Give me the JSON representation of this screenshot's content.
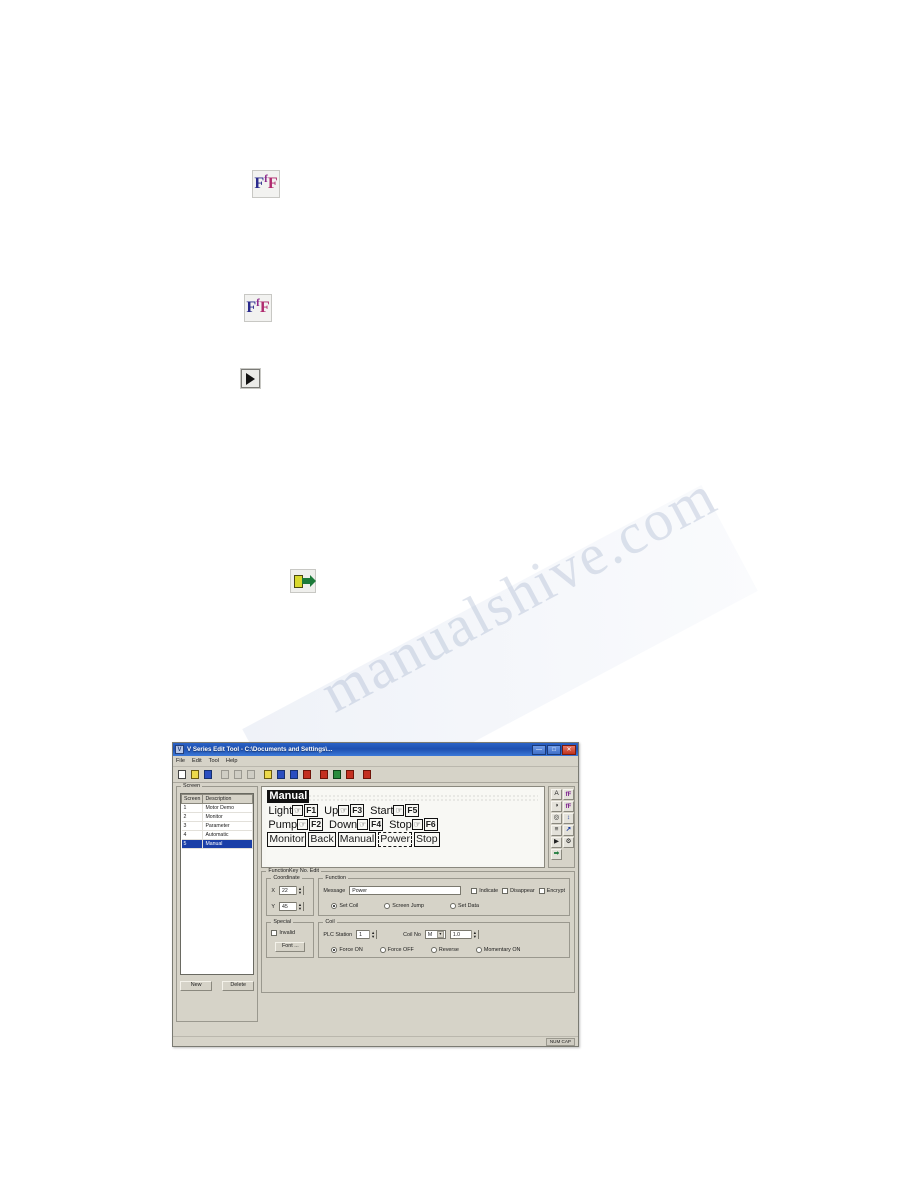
{
  "page": {
    "watermark_text_1": "manualshive.com",
    "watermark_text_2": ".com"
  },
  "page_icons": [
    {
      "name": "font-ff-icon-1",
      "glyph_left": "F",
      "glyph_mid": "f",
      "glyph_right": "F"
    },
    {
      "name": "font-ff-icon-2",
      "glyph_left": "F",
      "glyph_mid": "f",
      "glyph_right": "F"
    },
    {
      "name": "play-button-icon",
      "glyph": "▶"
    },
    {
      "name": "download-to-plc-icon",
      "glyph": "➡"
    }
  ],
  "window": {
    "title": "V Series Edit Tool - C:\\Documents and Settings\\...",
    "title_icon": "app-icon",
    "buttons": {
      "minimize": "—",
      "maximize": "□",
      "close": "✕"
    },
    "menu": [
      "File",
      "Edit",
      "Tool",
      "Help"
    ],
    "toolbar": [
      {
        "name": "new-file-button",
        "kind": "white"
      },
      {
        "name": "open-file-button",
        "kind": "yellow"
      },
      {
        "name": "save-file-button",
        "kind": "blue"
      },
      {
        "name": "cut-button",
        "kind": "disabled"
      },
      {
        "name": "copy-button",
        "kind": "disabled"
      },
      {
        "name": "paste-button",
        "kind": "disabled"
      },
      {
        "name": "screen-new-button",
        "kind": "yellow"
      },
      {
        "name": "screen-edit-button",
        "kind": "blue"
      },
      {
        "name": "screen-link-button",
        "kind": "blue"
      },
      {
        "name": "screen-delete-button",
        "kind": "red"
      },
      {
        "name": "upload-button",
        "kind": "red"
      },
      {
        "name": "download-button",
        "kind": "green"
      },
      {
        "name": "monitor-button",
        "kind": "red"
      },
      {
        "name": "transfer-button",
        "kind": "red"
      }
    ],
    "screen_group": {
      "legend": "Screen",
      "columns": [
        "Screen",
        "Description"
      ],
      "rows": [
        {
          "no": "1",
          "description": "Motor Demo",
          "selected": false
        },
        {
          "no": "2",
          "description": "Monitor",
          "selected": false
        },
        {
          "no": "3",
          "description": "Parameter",
          "selected": false
        },
        {
          "no": "4",
          "description": "Automatic",
          "selected": false
        },
        {
          "no": "5",
          "description": "Manual",
          "selected": true
        }
      ],
      "new_button": "New",
      "delete_button": "Delete"
    },
    "canvas": {
      "screen_title": "Manual",
      "function_rows": [
        [
          {
            "label": "Light",
            "key": "F1"
          },
          {
            "label": "Up",
            "key": "F3"
          },
          {
            "label": "Start",
            "key": "F5"
          }
        ],
        [
          {
            "label": "Pump",
            "key": "F2"
          },
          {
            "label": "Down",
            "key": "F4"
          },
          {
            "label": "Stop",
            "key": "F6"
          }
        ]
      ],
      "buttons": [
        {
          "label": "Monitor",
          "selected": false
        },
        {
          "label": "Back",
          "selected": false
        },
        {
          "label": "Manual",
          "selected": false
        },
        {
          "label": "Power",
          "selected": true
        },
        {
          "label": "Stop",
          "selected": false
        }
      ],
      "hand_glyph": "☞"
    },
    "palette": [
      {
        "name": "text-tool-button",
        "glyph": "A"
      },
      {
        "name": "font-tool-button",
        "glyph": "fF"
      },
      {
        "name": "lamp-tool-button",
        "glyph": "◑"
      },
      {
        "name": "function-key-tool-button",
        "glyph": "fF"
      },
      {
        "name": "switch-tool-button",
        "glyph": "◎"
      },
      {
        "name": "numeric-display-tool-button",
        "glyph": "↕"
      },
      {
        "name": "bar-graph-tool-button",
        "glyph": "≡"
      },
      {
        "name": "trend-graph-tool-button",
        "glyph": "↗"
      },
      {
        "name": "screen-tool-button",
        "glyph": "▶"
      },
      {
        "name": "settings-tool-button",
        "glyph": "⚙"
      },
      {
        "name": "export-tool-button",
        "glyph": "➡"
      }
    ],
    "properties": {
      "panel_title": "FunctionKey No. Edit",
      "coordinate": {
        "legend": "Coordinate",
        "x_label": "X",
        "x_value": "22",
        "y_label": "Y",
        "y_value": "45"
      },
      "function": {
        "legend": "Function",
        "message_label": "Message",
        "message_value": "Power",
        "checkboxes": [
          {
            "label": "Indicate",
            "checked": false
          },
          {
            "label": "Disappear",
            "checked": false
          },
          {
            "label": "Encrypt",
            "checked": false
          }
        ],
        "radios": [
          {
            "label": "Set Coil",
            "checked": true
          },
          {
            "label": "Screen Jump",
            "checked": false
          },
          {
            "label": "Set Data",
            "checked": false
          }
        ]
      },
      "special": {
        "legend": "Special",
        "invalid_label": "Invalid",
        "invalid_checked": false,
        "font_button": "Font ..."
      },
      "coil": {
        "legend": "Coil",
        "plc_station_label": "PLC Station",
        "plc_station_value": "1",
        "coil_no_label": "Coil No",
        "coil_type_value": "M",
        "coil_addr_value": "1.0",
        "radios": [
          {
            "label": "Force ON",
            "checked": true
          },
          {
            "label": "Force OFF",
            "checked": false
          },
          {
            "label": "Reverse",
            "checked": false
          },
          {
            "label": "Momentary ON",
            "checked": false
          }
        ]
      }
    },
    "statusbar": {
      "text": "NUM  CAP"
    }
  }
}
